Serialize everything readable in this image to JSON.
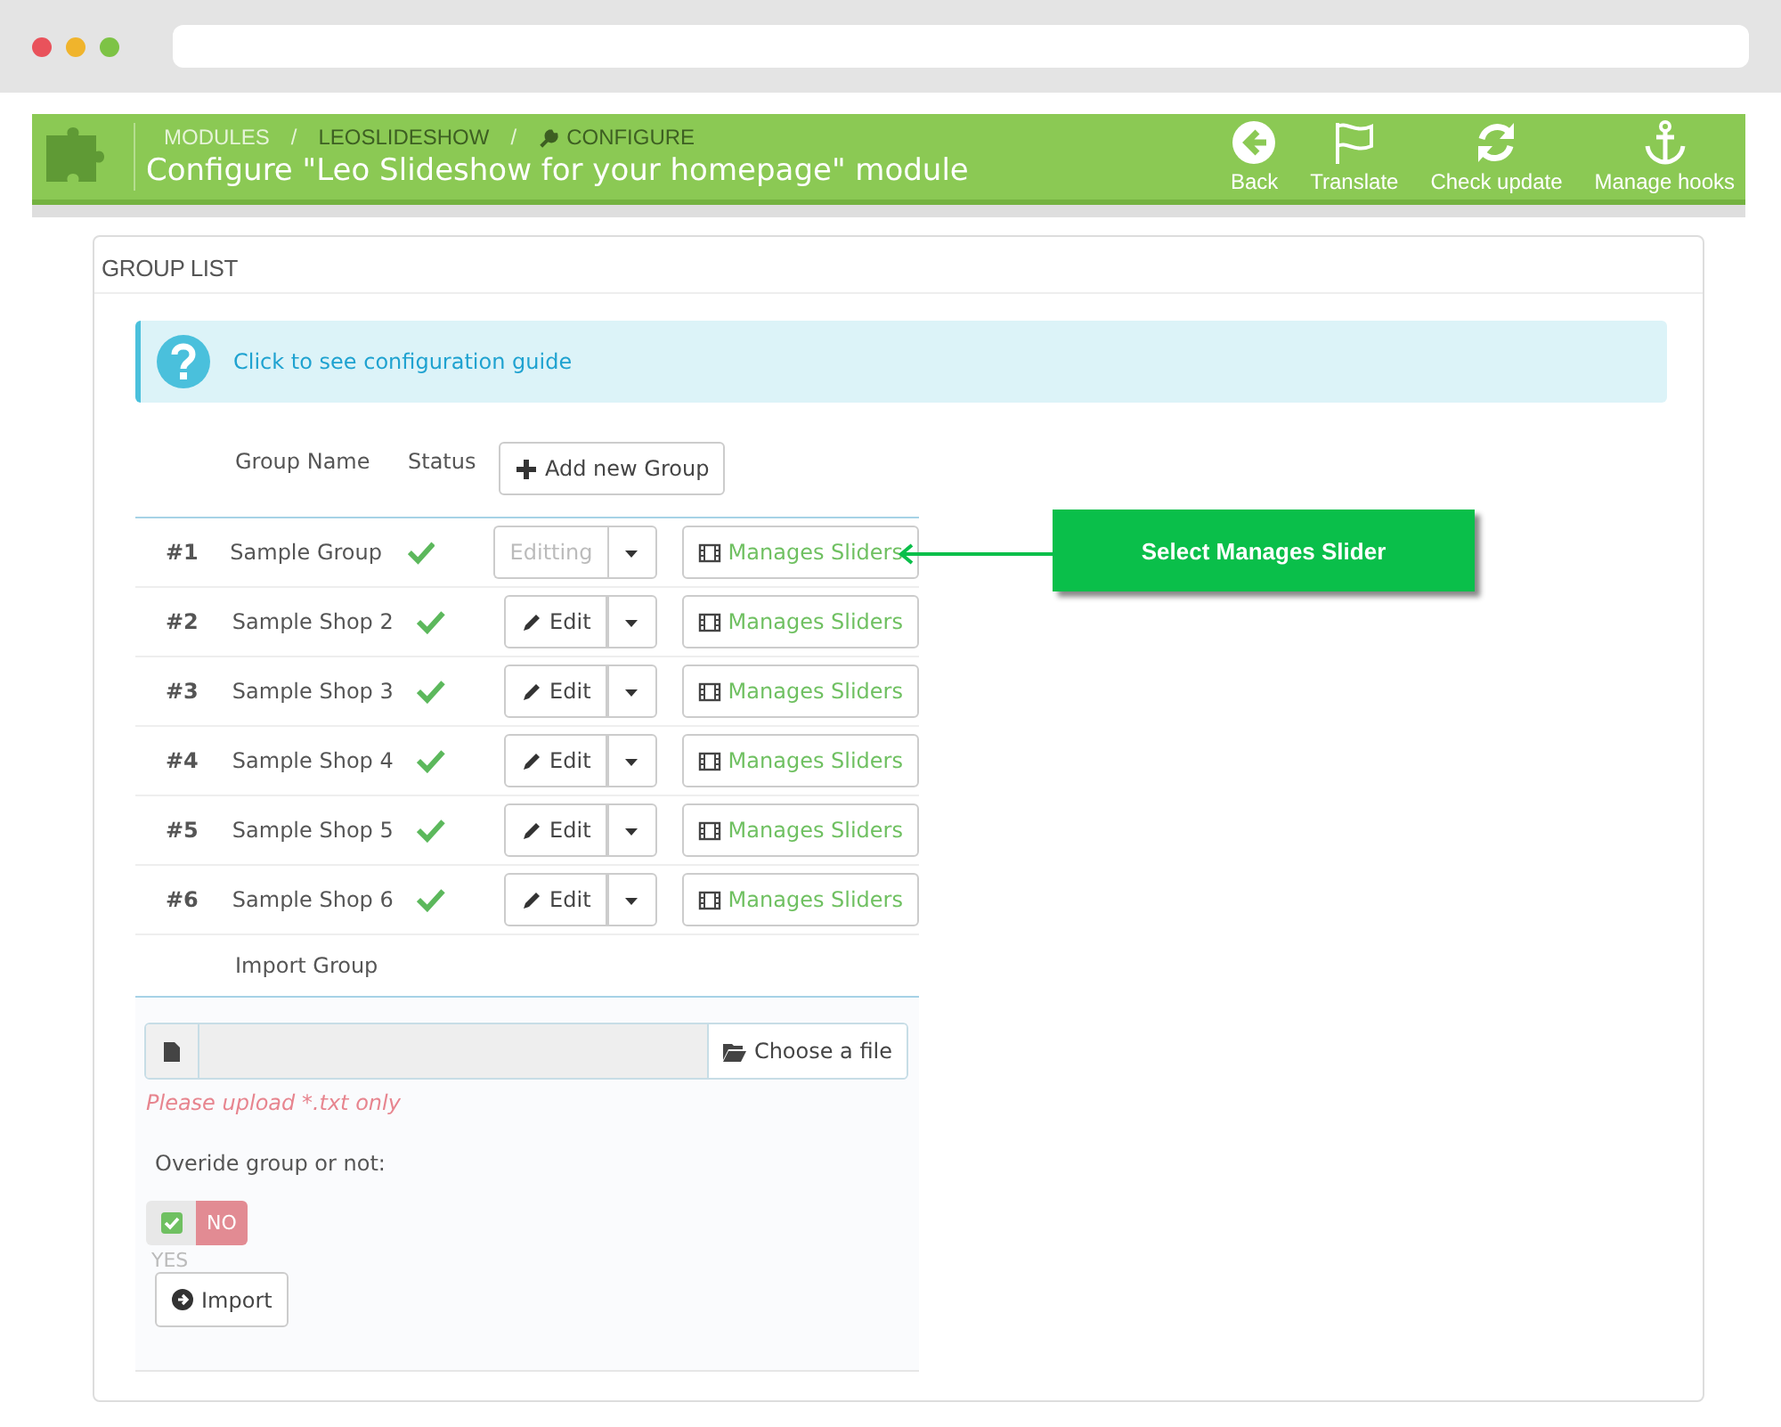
{
  "header": {
    "breadcrumbs": [
      {
        "label": "MODULES",
        "current": false
      },
      {
        "separator": "/",
        "label": "LEOSLIDESHOW",
        "current": true
      },
      {
        "separator": "/",
        "label": "CONFIGURE",
        "current": true
      }
    ],
    "title": "Configure \"Leo Slideshow for your homepage\" module",
    "toolbar": [
      {
        "label": "Back"
      },
      {
        "label": "Translate"
      },
      {
        "label": "Check update"
      },
      {
        "label": "Manage hooks"
      }
    ]
  },
  "panel": {
    "title": "GROUP LIST",
    "guide_link": "Click to see configuration guide",
    "table": {
      "columns": [
        "Group Name",
        "Status"
      ],
      "add_button": "Add new Group",
      "rows": [
        {
          "id": "#1",
          "name": "Sample Group",
          "active": true,
          "editing": true,
          "edit_label": "Editting",
          "manage_label": "Manages Sliders"
        },
        {
          "id": "#2",
          "name": "Sample Shop 2",
          "active": true,
          "editing": false,
          "edit_label": "Edit",
          "manage_label": "Manages Sliders"
        },
        {
          "id": "#3",
          "name": "Sample Shop 3",
          "active": true,
          "editing": false,
          "edit_label": "Edit",
          "manage_label": "Manages Sliders"
        },
        {
          "id": "#4",
          "name": "Sample Shop 4",
          "active": true,
          "editing": false,
          "edit_label": "Edit",
          "manage_label": "Manages Sliders"
        },
        {
          "id": "#5",
          "name": "Sample Shop 5",
          "active": true,
          "editing": false,
          "edit_label": "Edit",
          "manage_label": "Manages Sliders"
        },
        {
          "id": "#6",
          "name": "Sample Shop 6",
          "active": true,
          "editing": false,
          "edit_label": "Edit",
          "manage_label": "Manages Sliders"
        }
      ]
    },
    "import": {
      "title": "Import Group",
      "choose_button": "Choose a file",
      "hint": "Please upload *.txt only",
      "override_label": "Overide group or not:",
      "override": {
        "on": false,
        "yes_label": "YES",
        "no_label": "NO"
      },
      "import_button": "Import"
    }
  },
  "callout": {
    "text": "Select Manages Slider"
  }
}
